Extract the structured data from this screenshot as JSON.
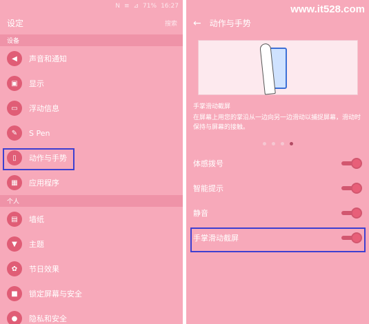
{
  "left": {
    "status": {
      "icons": [
        "N",
        "≡",
        "⊿"
      ],
      "battery": "71%",
      "time": "16:27"
    },
    "title": "设定",
    "search": "搜索",
    "sections": [
      {
        "header": "设备",
        "items": [
          {
            "label": "声音和通知",
            "icon": "speaker-icon",
            "glyph": "◀"
          },
          {
            "label": "显示",
            "icon": "display-icon",
            "glyph": "▣"
          },
          {
            "label": "浮动信息",
            "icon": "floating-messages-icon",
            "glyph": "▭"
          },
          {
            "label": "S Pen",
            "icon": "pen-icon",
            "glyph": "✎"
          },
          {
            "label": "动作与手势",
            "icon": "motion-gesture-icon",
            "glyph": "▯"
          },
          {
            "label": "应用程序",
            "icon": "apps-grid-icon",
            "glyph": "▦"
          }
        ]
      },
      {
        "header": "个人",
        "items": [
          {
            "label": "墙纸",
            "icon": "wallpaper-icon",
            "glyph": "▤"
          },
          {
            "label": "主题",
            "icon": "theme-brush-icon",
            "glyph": "▼"
          },
          {
            "label": "节日效果",
            "icon": "holiday-effect-icon",
            "glyph": "✿"
          },
          {
            "label": "锁定屏幕与安全",
            "icon": "lock-icon",
            "glyph": "■"
          },
          {
            "label": "隐私和安全",
            "icon": "privacy-icon",
            "glyph": "●"
          }
        ]
      }
    ]
  },
  "right": {
    "watermark": "www.it528.com",
    "title": "动作与手势",
    "illustration_caption": "手掌滑动截屏",
    "description": "在屏幕上用您的掌沿从一边向另一边滑动以捕捉屏幕，滑动时保持与屏幕的接触。",
    "page_dots": 4,
    "active_dot": 4,
    "toggles": [
      {
        "label": "体感拨号",
        "on": true
      },
      {
        "label": "智能提示",
        "on": true
      },
      {
        "label": "静音",
        "on": true
      },
      {
        "label": "手掌滑动截屏",
        "on": true
      }
    ]
  },
  "colors": {
    "background": "#f7a9ba",
    "accent": "#e05d76",
    "highlight_box": "#3d3fd0"
  }
}
